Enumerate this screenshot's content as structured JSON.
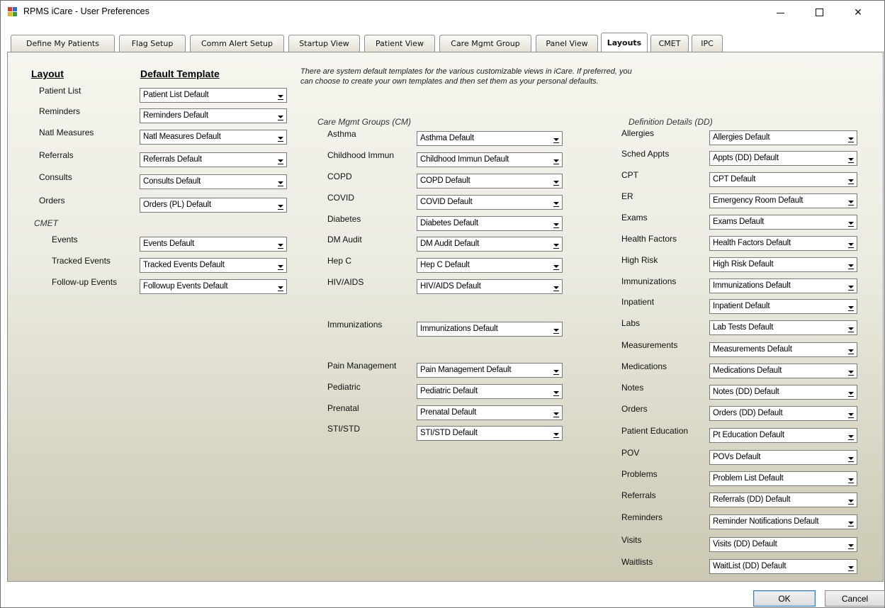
{
  "window": {
    "title": "RPMS iCare - User Preferences",
    "controls": {
      "minimize": "minimize-icon",
      "maximize": "maximize-icon",
      "close": "✕"
    }
  },
  "tabs": [
    {
      "label": "Define My Patients",
      "active": false
    },
    {
      "label": "Flag Setup",
      "active": false
    },
    {
      "label": "Comm Alert Setup",
      "active": false
    },
    {
      "label": "Startup View",
      "active": false
    },
    {
      "label": "Patient View",
      "active": false
    },
    {
      "label": "Care Mgmt Group",
      "active": false
    },
    {
      "label": "Panel View",
      "active": false
    },
    {
      "label": "Layouts",
      "active": true
    },
    {
      "label": "CMET",
      "active": false
    },
    {
      "label": "IPC",
      "active": false
    }
  ],
  "layouts": {
    "layout_header": "Layout",
    "template_header": "Default Template",
    "note": "There are system default templates for the various customizable views in iCare. If preferred, you can choose to create your own templates and then set them as your personal defaults.",
    "note_line1": "There are system default templates for the various customizable views in iCare. If preferred, you",
    "note_line2": "can choose to create your own templates and then set them as your personal defaults.",
    "main_rows": [
      {
        "label": "Patient List",
        "value": "Patient List Default"
      },
      {
        "label": "Reminders",
        "value": "Reminders Default"
      },
      {
        "label": "Natl Measures",
        "value": "Natl Measures Default"
      },
      {
        "label": "Referrals",
        "value": "Referrals Default"
      },
      {
        "label": "Consults",
        "value": "Consults Default"
      },
      {
        "label": "Orders",
        "value": "Orders (PL) Default"
      }
    ],
    "cmet_label": "CMET",
    "cmet_rows": [
      {
        "label": "Events",
        "value": "Events Default"
      },
      {
        "label": "Tracked Events",
        "value": "Tracked Events Default"
      },
      {
        "label": "Follow-up Events",
        "value": "Followup Events Default"
      }
    ],
    "cm_title": "Care Mgmt Groups (CM)",
    "cm_rows": [
      {
        "label": "Asthma",
        "value": "Asthma Default"
      },
      {
        "label": "Childhood Immun",
        "value": "Childhood Immun Default"
      },
      {
        "label": "COPD",
        "value": "COPD Default"
      },
      {
        "label": "COVID",
        "value": "COVID Default"
      },
      {
        "label": "Diabetes",
        "value": "Diabetes Default"
      },
      {
        "label": "DM Audit",
        "value": "DM Audit Default"
      },
      {
        "label": "Hep C",
        "value": "Hep C Default"
      },
      {
        "label": "HIV/AIDS",
        "value": "HIV/AIDS Default"
      },
      {
        "label": "Immunizations",
        "value": "Immunizations Default"
      },
      {
        "label": "Pain Management",
        "value": "Pain Management Default"
      },
      {
        "label": "Pediatric",
        "value": "Pediatric Default"
      },
      {
        "label": "Prenatal",
        "value": "Prenatal Default"
      },
      {
        "label": "STI/STD",
        "value": "STI/STD Default"
      }
    ],
    "dd_title": "Definition Details (DD)",
    "dd_rows": [
      {
        "label": "Allergies",
        "value": "Allergies Default"
      },
      {
        "label": "Sched Appts",
        "value": "Appts (DD) Default"
      },
      {
        "label": "CPT",
        "value": "CPT Default"
      },
      {
        "label": "ER",
        "value": "Emergency Room Default"
      },
      {
        "label": "Exams",
        "value": "Exams Default"
      },
      {
        "label": "Health Factors",
        "value": "Health Factors Default"
      },
      {
        "label": "High Risk",
        "value": "High Risk Default"
      },
      {
        "label": "Immunizations",
        "value": "Immunizations Default"
      },
      {
        "label": "Inpatient",
        "value": "Inpatient Default"
      },
      {
        "label": "Labs",
        "value": "Lab Tests Default"
      },
      {
        "label": "Measurements",
        "value": "Measurements Default"
      },
      {
        "label": "Medications",
        "value": "Medications Default"
      },
      {
        "label": "Notes",
        "value": "Notes (DD) Default"
      },
      {
        "label": "Orders",
        "value": "Orders (DD) Default"
      },
      {
        "label": "Patient Education",
        "value": "Pt Education Default"
      },
      {
        "label": "POV",
        "value": "POVs Default"
      },
      {
        "label": "Problems",
        "value": "Problem List Default"
      },
      {
        "label": "Referrals",
        "value": "Referrals (DD) Default"
      },
      {
        "label": "Reminders",
        "value": "Reminder Notifications Default"
      },
      {
        "label": "Visits",
        "value": "Visits (DD) Default"
      },
      {
        "label": "Waitlists",
        "value": "WaitList (DD) Default"
      }
    ]
  },
  "footer": {
    "ok_label": "OK",
    "cancel_label": "Cancel"
  }
}
